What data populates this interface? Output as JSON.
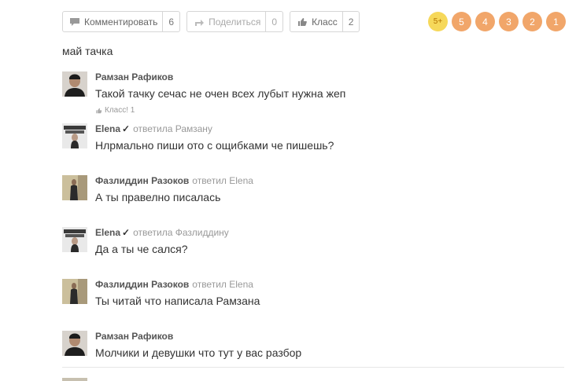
{
  "toolbar": {
    "comment_label": "Комментировать",
    "comment_count": "6",
    "share_label": "Поделиться",
    "share_count": "0",
    "like_label": "Класс",
    "like_count": "2"
  },
  "ratings": [
    "5+",
    "5",
    "4",
    "3",
    "2",
    "1"
  ],
  "topic": "май тачка",
  "comments": [
    {
      "author": "Рамзан Рафиков",
      "reply": "",
      "text": "Такой тачку сечас не очен всех лубыт нужна жеп",
      "likes": "Класс! 1"
    },
    {
      "author": "Elena",
      "verified": "✓",
      "reply": "ответила Рамзану",
      "text": "Нлрмально пиши ото с ощибками че пишешь?"
    },
    {
      "author": "Фазлиддин Разоков",
      "reply": "ответил Elena",
      "text": "А ты правелно писалась"
    },
    {
      "author": "Elena",
      "verified": "✓",
      "reply": "ответила Фазлиддину",
      "text": "Да а ты че сался?"
    },
    {
      "author": "Фазлиддин Разоков",
      "reply": "ответил Elena",
      "text": "Ты читай что написала Рамзана"
    },
    {
      "author": "Рамзан Рафиков",
      "reply": "",
      "text": "Молчики и девушки что тут у вас разбор"
    }
  ],
  "colors": {
    "rating": "#f1a66a",
    "rating_top": "#f6d85a",
    "reply": "#999999"
  }
}
